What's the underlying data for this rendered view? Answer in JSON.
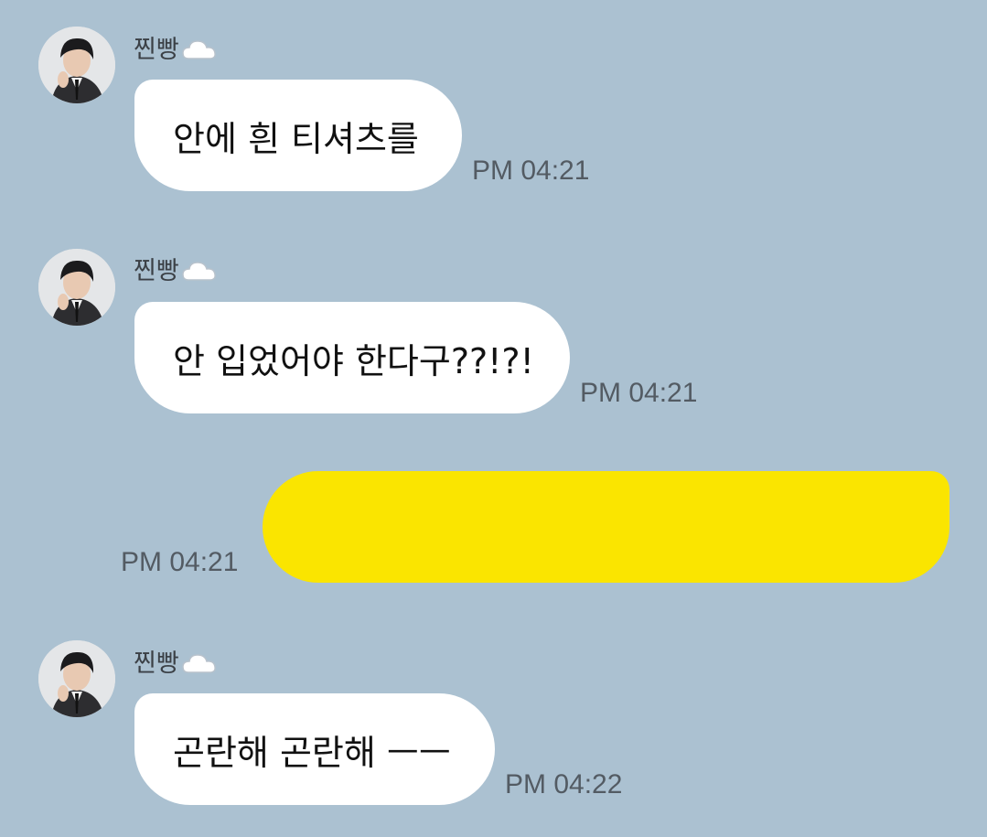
{
  "messages": [
    {
      "sender": "찐빵",
      "sender_emoji": "cloud-icon",
      "text": "안에 흰 티셔츠를",
      "time": "PM 04:21",
      "direction": "incoming"
    },
    {
      "sender": "찐빵",
      "sender_emoji": "cloud-icon",
      "text": "안 입었어야 한다구??!?!",
      "time": "PM 04:21",
      "direction": "incoming"
    },
    {
      "sender": "",
      "text": "",
      "time": "PM 04:21",
      "direction": "outgoing"
    },
    {
      "sender": "찐빵",
      "sender_emoji": "cloud-icon",
      "text": "곤란해 곤란해 ㅡㅡ",
      "time": "PM 04:22",
      "direction": "incoming"
    }
  ],
  "colors": {
    "background": "#abc1d1",
    "incoming_bubble": "#ffffff",
    "outgoing_bubble": "#fae500",
    "time_text": "#535b63"
  }
}
